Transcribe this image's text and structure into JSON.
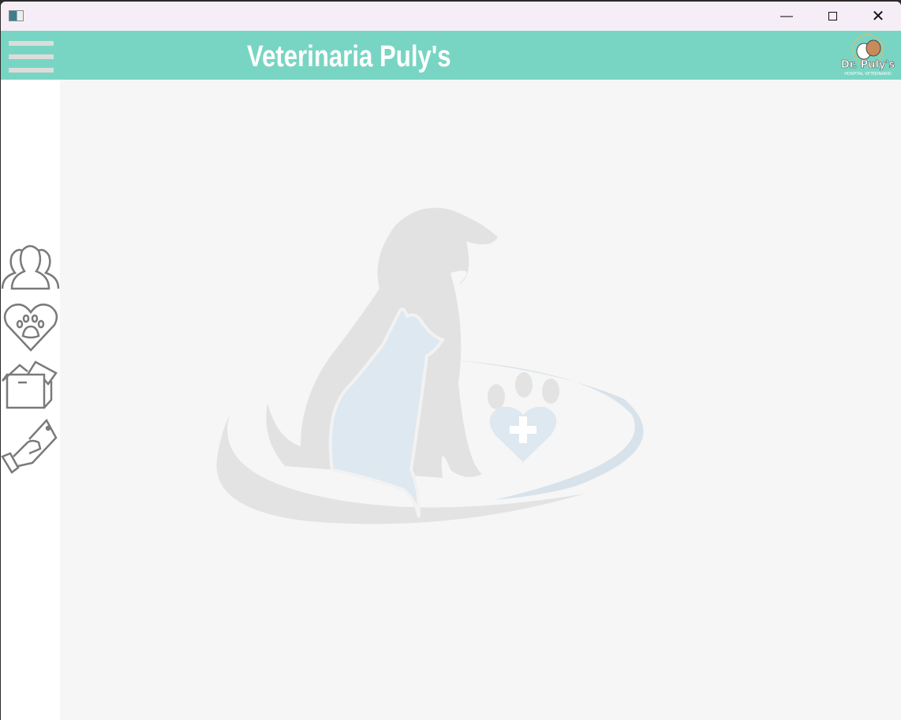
{
  "window": {
    "minimize_icon": "minimize-icon",
    "maximize_icon": "maximize-icon",
    "close_icon": "close-icon"
  },
  "header": {
    "title": "Veterinaria Puly's",
    "menu_icon": "hamburger-icon",
    "brand_logo_text": "Dr. Puly's",
    "brand_logo_subtext": "HOSPITAL VETERINARIO",
    "background": "#78d5c3"
  },
  "sidebar": {
    "items": [
      {
        "icon": "clients-icon"
      },
      {
        "icon": "pets-heart-paw-icon"
      },
      {
        "icon": "box-inventory-icon"
      },
      {
        "icon": "hand-money-payment-icon"
      }
    ]
  },
  "main": {
    "watermark": "dog-cat-paw-logo"
  }
}
